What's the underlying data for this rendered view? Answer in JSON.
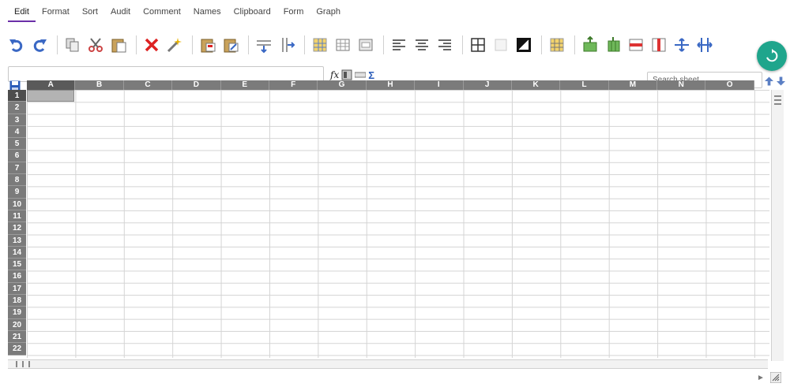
{
  "menu": {
    "tabs": [
      {
        "label": "Edit",
        "active": true
      },
      {
        "label": "Format"
      },
      {
        "label": "Sort"
      },
      {
        "label": "Audit"
      },
      {
        "label": "Comment"
      },
      {
        "label": "Names"
      },
      {
        "label": "Clipboard"
      },
      {
        "label": "Form"
      },
      {
        "label": "Graph"
      }
    ]
  },
  "toolbar": {
    "groups": [
      [
        "undo-icon",
        "redo-icon"
      ],
      [
        "copy-icon",
        "cut-icon",
        "paste-icon"
      ],
      [
        "delete-icon",
        "wand-icon"
      ],
      [
        "paste-formats-icon",
        "paste-values-icon"
      ],
      [
        "insert-row-icon",
        "insert-column-icon"
      ],
      [
        "fill-color-icon",
        "cell-grid-icon",
        "merge-cells-icon"
      ],
      [
        "align-left-icon",
        "align-center-icon",
        "align-right-icon"
      ],
      [
        "borders-icon",
        "no-border-icon",
        "swap-colors-icon"
      ],
      [
        "column-highlight-icon"
      ],
      [
        "insert-rows-above-icon",
        "insert-cols-left-icon",
        "delete-row-icon",
        "delete-column-icon",
        "move-row-icon",
        "move-column-icon"
      ]
    ],
    "accent": "#1fa58c"
  },
  "formula_bar": {
    "value": "",
    "fx_label": "fx",
    "sum_label": "Σ"
  },
  "search": {
    "placeholder": "Search sheet..."
  },
  "grid": {
    "columns": [
      "A",
      "B",
      "C",
      "D",
      "E",
      "F",
      "G",
      "H",
      "I",
      "J",
      "K",
      "L",
      "M",
      "N",
      "O"
    ],
    "rows": [
      "1",
      "2",
      "3",
      "4",
      "5",
      "6",
      "7",
      "8",
      "9",
      "10",
      "11",
      "12",
      "13",
      "14",
      "15",
      "16",
      "17",
      "18",
      "19",
      "20",
      "21",
      "22"
    ],
    "active_cell": "A1",
    "header_color": "#7b7b7b"
  }
}
